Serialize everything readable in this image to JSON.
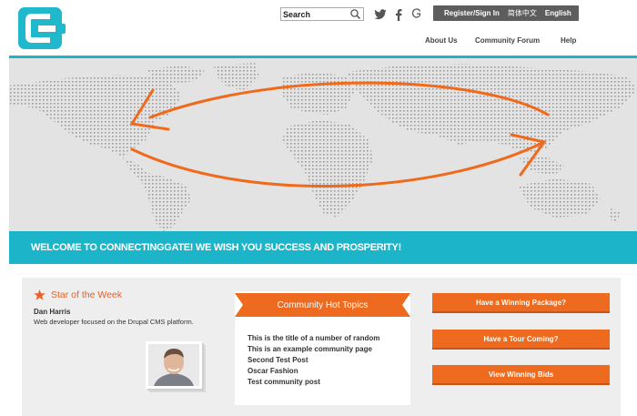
{
  "header": {
    "search": {
      "placeholder": "Search"
    },
    "social": [
      "twitter-icon",
      "facebook-icon",
      "google-plus-icon"
    ],
    "lang_bar": {
      "register": "Register/Sign In",
      "chinese": "简体中文",
      "english": "English"
    },
    "nav": [
      "About Us",
      "Community Forum",
      "Help"
    ]
  },
  "banner": {
    "welcome": "WELCOME TO CONNECTINGGATE! WE WISH YOU SUCCESS AND PROSPERITY!"
  },
  "star": {
    "title": "Star of the Week",
    "name": "Dan Harris",
    "description": "Web developer focused on the Drupal CMS platform."
  },
  "hot_topics": {
    "title": "Community Hot Topics",
    "items": [
      "This is the title of a number of random",
      "This is an example community page",
      "Second Test Post",
      "Oscar Fashion",
      "Test community post"
    ]
  },
  "buttons": [
    "Have a Winning Package?",
    "Have a Tour Coming?",
    "View Winning Bids"
  ],
  "colors": {
    "teal": "#1cb4c9",
    "orange": "#ee6a1f",
    "dark_bar": "#5d5d5d"
  }
}
